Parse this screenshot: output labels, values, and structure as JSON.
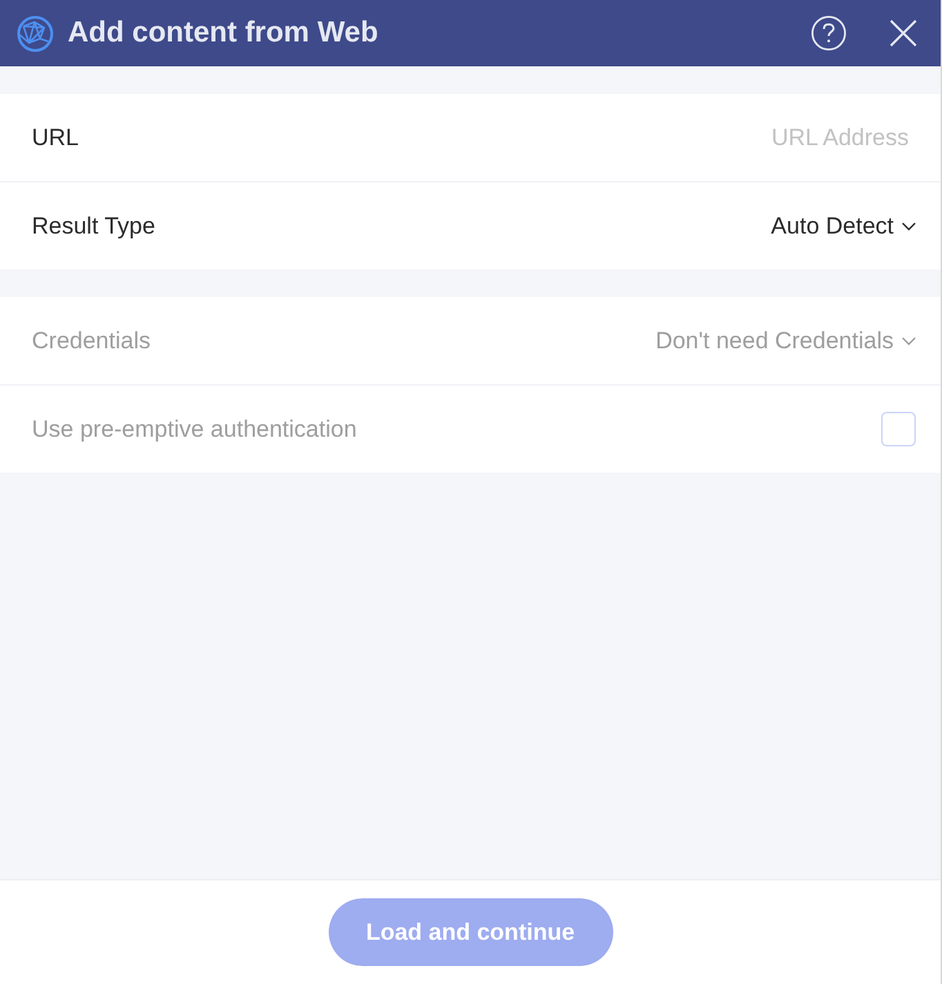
{
  "dialog": {
    "title": "Add content from Web"
  },
  "sections": [
    {
      "fields": [
        {
          "kind": "text",
          "label": "URL",
          "placeholder": "URL Address",
          "disabled": false
        },
        {
          "kind": "select",
          "label": "Result Type",
          "value": "Auto Detect",
          "disabled": false
        }
      ]
    },
    {
      "fields": [
        {
          "kind": "select",
          "label": "Credentials",
          "value": "Don't need Credentials",
          "disabled": true
        },
        {
          "kind": "checkbox",
          "label": "Use pre-emptive authentication",
          "checked": false,
          "disabled": true
        }
      ]
    }
  ],
  "footer": {
    "button": {
      "label": "Load and continue",
      "disabled": true
    }
  }
}
